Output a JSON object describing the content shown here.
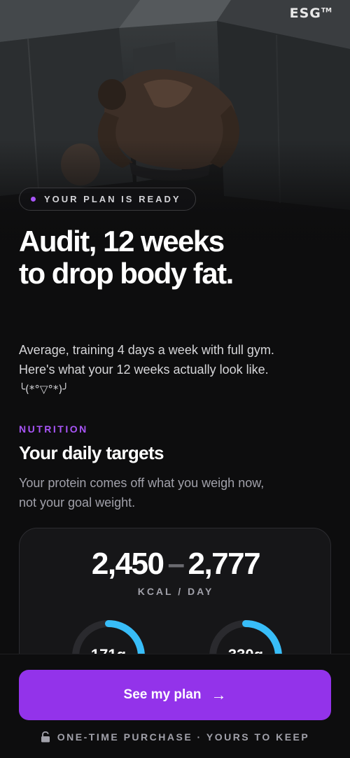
{
  "brand": {
    "logo": "ESG",
    "trademark": "TM"
  },
  "hero": {
    "status": "YOUR PLAN IS READY",
    "headline_line1": "Audit, 12 weeks",
    "headline_line2": "to drop body fat."
  },
  "intro": {
    "line1": "Average, training 4 days a week with full gym.",
    "line2": "Here's what your 12 weeks actually look like.",
    "emoticon": "╰(*°▽°*)╯"
  },
  "nutrition": {
    "eyebrow": "NUTRITION",
    "title": "Your daily targets",
    "subtitle_line1": "Your protein comes off what you weigh now,",
    "subtitle_line2": "not your goal weight.",
    "kcal_low": "2,450",
    "kcal_separator": "–",
    "kcal_high": "2,777",
    "kcal_unit": "KCAL / DAY",
    "macros": [
      {
        "value": "171g",
        "progress": 0.3,
        "color": "#38bdf8"
      },
      {
        "value": "330g",
        "progress": 0.3,
        "color": "#38bdf8"
      }
    ]
  },
  "cta": {
    "label": "See my plan",
    "arrow": "→",
    "footnote": "ONE-TIME PURCHASE · YOURS TO KEEP",
    "color": "#9333ea"
  },
  "colors": {
    "accent": "#a855f7",
    "background": "#0d0d0e",
    "ring": "#38bdf8"
  }
}
